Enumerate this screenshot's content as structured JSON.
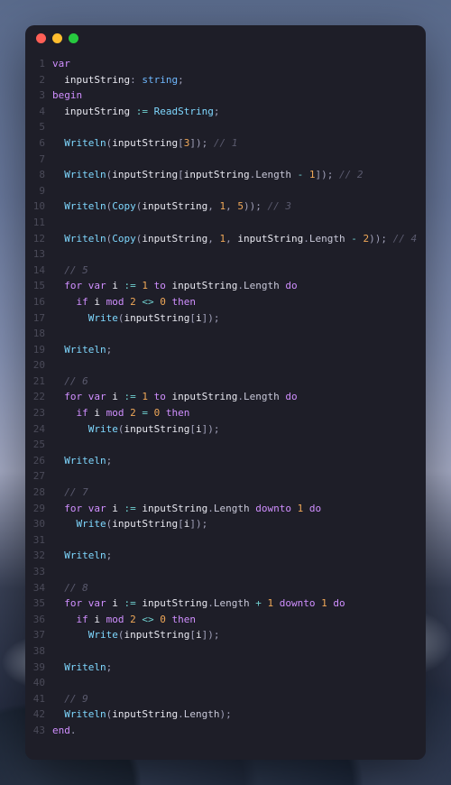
{
  "window": {
    "traffic_lights": [
      "red",
      "yellow",
      "green"
    ]
  },
  "colors": {
    "bg": "#1e1e28",
    "keyword": "#d08fff",
    "type": "#6fb8ff",
    "func": "#7fd8ff",
    "number": "#f0a858",
    "operator": "#70d0d0",
    "comment": "#5a5a6e"
  },
  "code": {
    "lines": [
      {
        "n": 1,
        "t": [
          [
            "kw",
            "var"
          ]
        ]
      },
      {
        "n": 2,
        "t": [
          [
            "sp",
            "  "
          ],
          [
            "ident",
            "inputString"
          ],
          [
            "punct",
            ": "
          ],
          [
            "type",
            "string"
          ],
          [
            "punct",
            ";"
          ]
        ]
      },
      {
        "n": 3,
        "t": [
          [
            "kw",
            "begin"
          ]
        ]
      },
      {
        "n": 4,
        "t": [
          [
            "sp",
            "  "
          ],
          [
            "ident",
            "inputString"
          ],
          [
            "punct",
            " "
          ],
          [
            "op",
            ":="
          ],
          [
            "punct",
            " "
          ],
          [
            "func",
            "ReadString"
          ],
          [
            "punct",
            ";"
          ]
        ]
      },
      {
        "n": 5,
        "t": []
      },
      {
        "n": 6,
        "t": [
          [
            "sp",
            "  "
          ],
          [
            "func",
            "Writeln"
          ],
          [
            "punct",
            "("
          ],
          [
            "ident",
            "inputString"
          ],
          [
            "punct",
            "["
          ],
          [
            "num",
            "3"
          ],
          [
            "punct",
            "]); "
          ],
          [
            "comment",
            "// 1"
          ]
        ]
      },
      {
        "n": 7,
        "t": []
      },
      {
        "n": 8,
        "t": [
          [
            "sp",
            "  "
          ],
          [
            "func",
            "Writeln"
          ],
          [
            "punct",
            "("
          ],
          [
            "ident",
            "inputString"
          ],
          [
            "punct",
            "["
          ],
          [
            "ident",
            "inputString"
          ],
          [
            "punct",
            "."
          ],
          [
            "prop",
            "Length"
          ],
          [
            "punct",
            " "
          ],
          [
            "op",
            "-"
          ],
          [
            "punct",
            " "
          ],
          [
            "num",
            "1"
          ],
          [
            "punct",
            "]); "
          ],
          [
            "comment",
            "// 2"
          ]
        ]
      },
      {
        "n": 9,
        "t": []
      },
      {
        "n": 10,
        "t": [
          [
            "sp",
            "  "
          ],
          [
            "func",
            "Writeln"
          ],
          [
            "punct",
            "("
          ],
          [
            "func",
            "Copy"
          ],
          [
            "punct",
            "("
          ],
          [
            "ident",
            "inputString"
          ],
          [
            "punct",
            ", "
          ],
          [
            "num",
            "1"
          ],
          [
            "punct",
            ", "
          ],
          [
            "num",
            "5"
          ],
          [
            "punct",
            ")); "
          ],
          [
            "comment",
            "// 3"
          ]
        ]
      },
      {
        "n": 11,
        "t": []
      },
      {
        "n": 12,
        "t": [
          [
            "sp",
            "  "
          ],
          [
            "func",
            "Writeln"
          ],
          [
            "punct",
            "("
          ],
          [
            "func",
            "Copy"
          ],
          [
            "punct",
            "("
          ],
          [
            "ident",
            "inputString"
          ],
          [
            "punct",
            ", "
          ],
          [
            "num",
            "1"
          ],
          [
            "punct",
            ", "
          ],
          [
            "ident",
            "inputString"
          ],
          [
            "punct",
            "."
          ],
          [
            "prop",
            "Length"
          ],
          [
            "punct",
            " "
          ],
          [
            "op",
            "-"
          ],
          [
            "punct",
            " "
          ],
          [
            "num",
            "2"
          ],
          [
            "punct",
            ")); "
          ],
          [
            "comment",
            "// 4"
          ]
        ]
      },
      {
        "n": 13,
        "t": []
      },
      {
        "n": 14,
        "t": [
          [
            "sp",
            "  "
          ],
          [
            "comment",
            "// 5"
          ]
        ]
      },
      {
        "n": 15,
        "t": [
          [
            "sp",
            "  "
          ],
          [
            "kw",
            "for"
          ],
          [
            "sp",
            " "
          ],
          [
            "kw",
            "var"
          ],
          [
            "sp",
            " "
          ],
          [
            "ident",
            "i"
          ],
          [
            "punct",
            " "
          ],
          [
            "op",
            ":="
          ],
          [
            "punct",
            " "
          ],
          [
            "num",
            "1"
          ],
          [
            "sp",
            " "
          ],
          [
            "kw",
            "to"
          ],
          [
            "sp",
            " "
          ],
          [
            "ident",
            "inputString"
          ],
          [
            "punct",
            "."
          ],
          [
            "prop",
            "Length"
          ],
          [
            "sp",
            " "
          ],
          [
            "kw",
            "do"
          ]
        ]
      },
      {
        "n": 16,
        "t": [
          [
            "sp",
            "    "
          ],
          [
            "kw",
            "if"
          ],
          [
            "sp",
            " "
          ],
          [
            "ident",
            "i"
          ],
          [
            "sp",
            " "
          ],
          [
            "kw",
            "mod"
          ],
          [
            "sp",
            " "
          ],
          [
            "num",
            "2"
          ],
          [
            "sp",
            " "
          ],
          [
            "op",
            "<>"
          ],
          [
            "sp",
            " "
          ],
          [
            "num",
            "0"
          ],
          [
            "sp",
            " "
          ],
          [
            "kw",
            "then"
          ]
        ]
      },
      {
        "n": 17,
        "t": [
          [
            "sp",
            "      "
          ],
          [
            "func",
            "Write"
          ],
          [
            "punct",
            "("
          ],
          [
            "ident",
            "inputString"
          ],
          [
            "punct",
            "["
          ],
          [
            "ident",
            "i"
          ],
          [
            "punct",
            "]);"
          ]
        ]
      },
      {
        "n": 18,
        "t": []
      },
      {
        "n": 19,
        "t": [
          [
            "sp",
            "  "
          ],
          [
            "func",
            "Writeln"
          ],
          [
            "punct",
            ";"
          ]
        ]
      },
      {
        "n": 20,
        "t": []
      },
      {
        "n": 21,
        "t": [
          [
            "sp",
            "  "
          ],
          [
            "comment",
            "// 6"
          ]
        ]
      },
      {
        "n": 22,
        "t": [
          [
            "sp",
            "  "
          ],
          [
            "kw",
            "for"
          ],
          [
            "sp",
            " "
          ],
          [
            "kw",
            "var"
          ],
          [
            "sp",
            " "
          ],
          [
            "ident",
            "i"
          ],
          [
            "punct",
            " "
          ],
          [
            "op",
            ":="
          ],
          [
            "punct",
            " "
          ],
          [
            "num",
            "1"
          ],
          [
            "sp",
            " "
          ],
          [
            "kw",
            "to"
          ],
          [
            "sp",
            " "
          ],
          [
            "ident",
            "inputString"
          ],
          [
            "punct",
            "."
          ],
          [
            "prop",
            "Length"
          ],
          [
            "sp",
            " "
          ],
          [
            "kw",
            "do"
          ]
        ]
      },
      {
        "n": 23,
        "t": [
          [
            "sp",
            "    "
          ],
          [
            "kw",
            "if"
          ],
          [
            "sp",
            " "
          ],
          [
            "ident",
            "i"
          ],
          [
            "sp",
            " "
          ],
          [
            "kw",
            "mod"
          ],
          [
            "sp",
            " "
          ],
          [
            "num",
            "2"
          ],
          [
            "sp",
            " "
          ],
          [
            "op",
            "="
          ],
          [
            "sp",
            " "
          ],
          [
            "num",
            "0"
          ],
          [
            "sp",
            " "
          ],
          [
            "kw",
            "then"
          ]
        ]
      },
      {
        "n": 24,
        "t": [
          [
            "sp",
            "      "
          ],
          [
            "func",
            "Write"
          ],
          [
            "punct",
            "("
          ],
          [
            "ident",
            "inputString"
          ],
          [
            "punct",
            "["
          ],
          [
            "ident",
            "i"
          ],
          [
            "punct",
            "]);"
          ]
        ]
      },
      {
        "n": 25,
        "t": []
      },
      {
        "n": 26,
        "t": [
          [
            "sp",
            "  "
          ],
          [
            "func",
            "Writeln"
          ],
          [
            "punct",
            ";"
          ]
        ]
      },
      {
        "n": 27,
        "t": []
      },
      {
        "n": 28,
        "t": [
          [
            "sp",
            "  "
          ],
          [
            "comment",
            "// 7"
          ]
        ]
      },
      {
        "n": 29,
        "t": [
          [
            "sp",
            "  "
          ],
          [
            "kw",
            "for"
          ],
          [
            "sp",
            " "
          ],
          [
            "kw",
            "var"
          ],
          [
            "sp",
            " "
          ],
          [
            "ident",
            "i"
          ],
          [
            "punct",
            " "
          ],
          [
            "op",
            ":="
          ],
          [
            "punct",
            " "
          ],
          [
            "ident",
            "inputString"
          ],
          [
            "punct",
            "."
          ],
          [
            "prop",
            "Length"
          ],
          [
            "sp",
            " "
          ],
          [
            "kw",
            "downto"
          ],
          [
            "sp",
            " "
          ],
          [
            "num",
            "1"
          ],
          [
            "sp",
            " "
          ],
          [
            "kw",
            "do"
          ]
        ]
      },
      {
        "n": 30,
        "t": [
          [
            "sp",
            "    "
          ],
          [
            "func",
            "Write"
          ],
          [
            "punct",
            "("
          ],
          [
            "ident",
            "inputString"
          ],
          [
            "punct",
            "["
          ],
          [
            "ident",
            "i"
          ],
          [
            "punct",
            "]);"
          ]
        ]
      },
      {
        "n": 31,
        "t": []
      },
      {
        "n": 32,
        "t": [
          [
            "sp",
            "  "
          ],
          [
            "func",
            "Writeln"
          ],
          [
            "punct",
            ";"
          ]
        ]
      },
      {
        "n": 33,
        "t": []
      },
      {
        "n": 34,
        "t": [
          [
            "sp",
            "  "
          ],
          [
            "comment",
            "// 8"
          ]
        ]
      },
      {
        "n": 35,
        "t": [
          [
            "sp",
            "  "
          ],
          [
            "kw",
            "for"
          ],
          [
            "sp",
            " "
          ],
          [
            "kw",
            "var"
          ],
          [
            "sp",
            " "
          ],
          [
            "ident",
            "i"
          ],
          [
            "punct",
            " "
          ],
          [
            "op",
            ":="
          ],
          [
            "punct",
            " "
          ],
          [
            "ident",
            "inputString"
          ],
          [
            "punct",
            "."
          ],
          [
            "prop",
            "Length"
          ],
          [
            "punct",
            " "
          ],
          [
            "op",
            "+"
          ],
          [
            "punct",
            " "
          ],
          [
            "num",
            "1"
          ],
          [
            "sp",
            " "
          ],
          [
            "kw",
            "downto"
          ],
          [
            "sp",
            " "
          ],
          [
            "num",
            "1"
          ],
          [
            "sp",
            " "
          ],
          [
            "kw",
            "do"
          ]
        ]
      },
      {
        "n": 36,
        "t": [
          [
            "sp",
            "    "
          ],
          [
            "kw",
            "if"
          ],
          [
            "sp",
            " "
          ],
          [
            "ident",
            "i"
          ],
          [
            "sp",
            " "
          ],
          [
            "kw",
            "mod"
          ],
          [
            "sp",
            " "
          ],
          [
            "num",
            "2"
          ],
          [
            "sp",
            " "
          ],
          [
            "op",
            "<>"
          ],
          [
            "sp",
            " "
          ],
          [
            "num",
            "0"
          ],
          [
            "sp",
            " "
          ],
          [
            "kw",
            "then"
          ]
        ]
      },
      {
        "n": 37,
        "t": [
          [
            "sp",
            "      "
          ],
          [
            "func",
            "Write"
          ],
          [
            "punct",
            "("
          ],
          [
            "ident",
            "inputString"
          ],
          [
            "punct",
            "["
          ],
          [
            "ident",
            "i"
          ],
          [
            "punct",
            "]);"
          ]
        ]
      },
      {
        "n": 38,
        "t": []
      },
      {
        "n": 39,
        "t": [
          [
            "sp",
            "  "
          ],
          [
            "func",
            "Writeln"
          ],
          [
            "punct",
            ";"
          ]
        ]
      },
      {
        "n": 40,
        "t": []
      },
      {
        "n": 41,
        "t": [
          [
            "sp",
            "  "
          ],
          [
            "comment",
            "// 9"
          ]
        ]
      },
      {
        "n": 42,
        "t": [
          [
            "sp",
            "  "
          ],
          [
            "func",
            "Writeln"
          ],
          [
            "punct",
            "("
          ],
          [
            "ident",
            "inputString"
          ],
          [
            "punct",
            "."
          ],
          [
            "prop",
            "Length"
          ],
          [
            "punct",
            ");"
          ]
        ]
      },
      {
        "n": 43,
        "t": [
          [
            "kw",
            "end"
          ],
          [
            "punct",
            "."
          ]
        ]
      }
    ]
  }
}
